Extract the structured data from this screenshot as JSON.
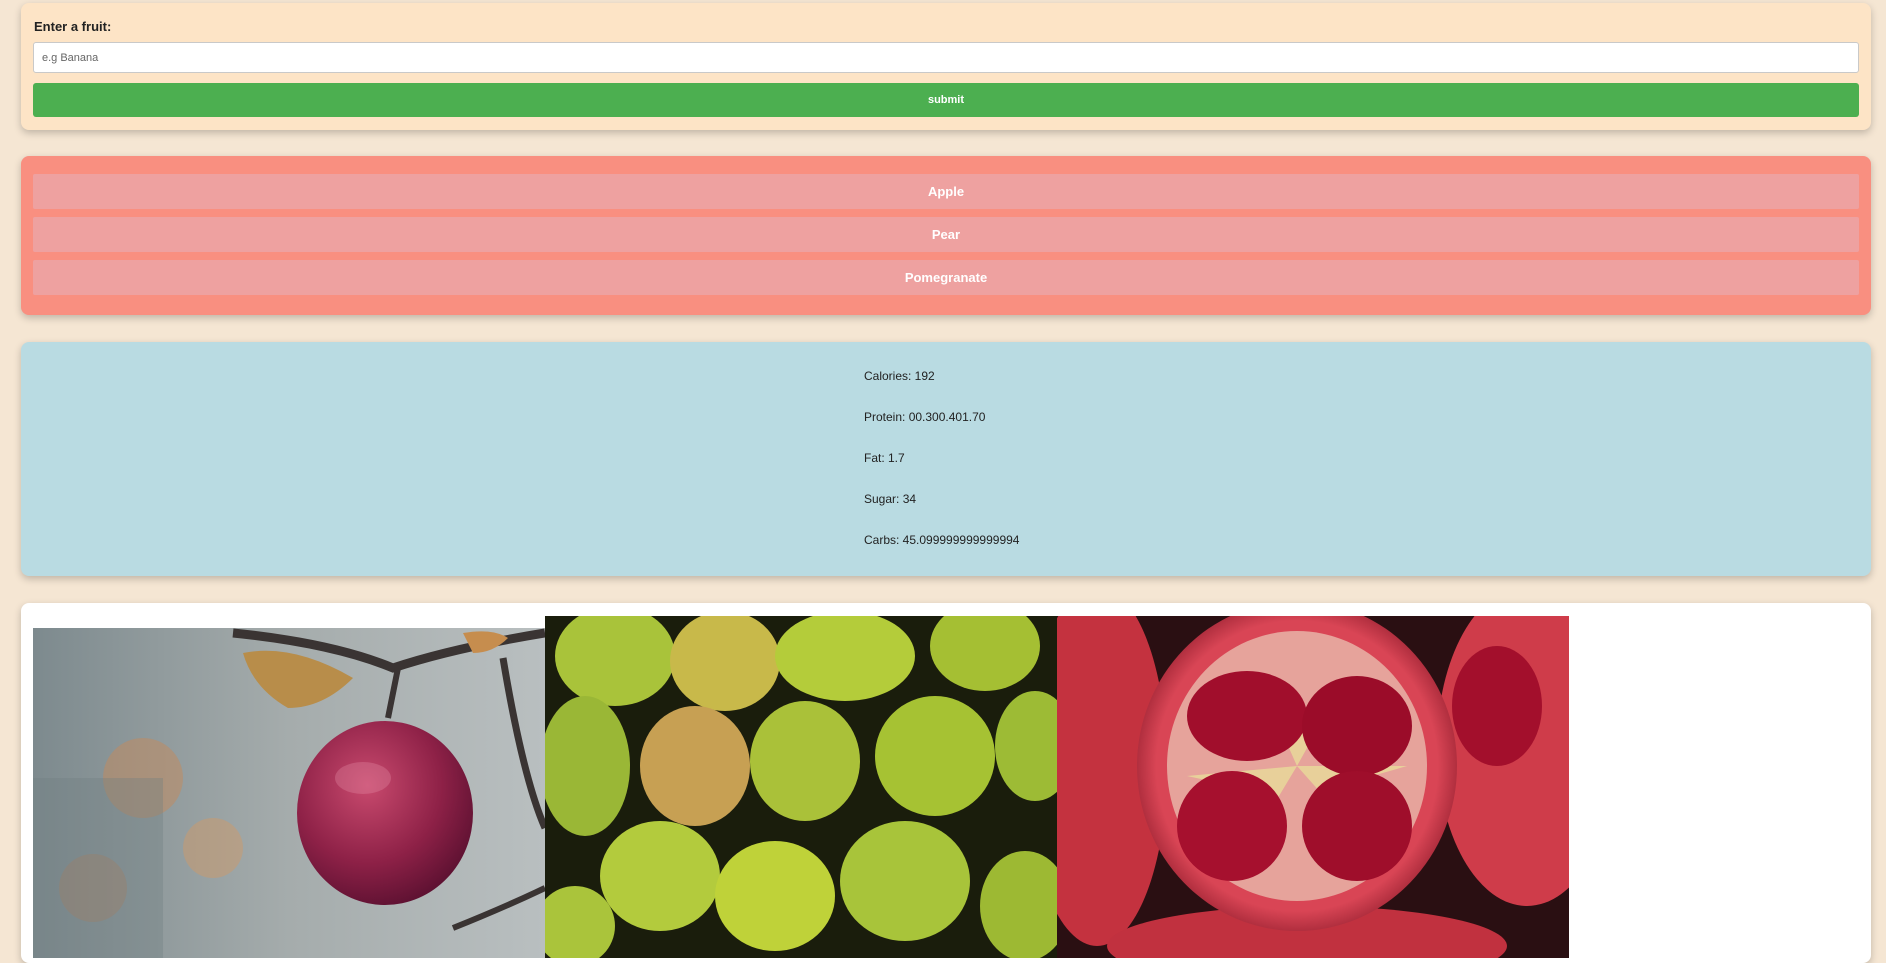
{
  "form": {
    "label": "Enter a fruit:",
    "input_value": "",
    "input_placeholder": "e.g Banana",
    "submit_label": "submit",
    "submit_color": "#4caf50"
  },
  "fruit_list": {
    "items": [
      {
        "label": "Apple"
      },
      {
        "label": "Pear"
      },
      {
        "label": "Pomegranate"
      }
    ]
  },
  "nutrition": {
    "calories": "Calories: 192",
    "protein": "Protein: 00.300.401.70",
    "fat": "Fat: 1.7",
    "sugar": "Sugar: 34",
    "carbs": "Carbs: 45.099999999999994"
  },
  "gallery": {
    "images": [
      {
        "subject": "apple-photo"
      },
      {
        "subject": "pears-photo"
      },
      {
        "subject": "pomegranate-photo"
      }
    ]
  },
  "colors": {
    "page_bg": "#f5e6d3",
    "form_bg": "#fde4c6",
    "list_bg": "#f98f80",
    "list_button_bg": "#eea1a0",
    "nutrition_bg": "#b9dbe2"
  }
}
